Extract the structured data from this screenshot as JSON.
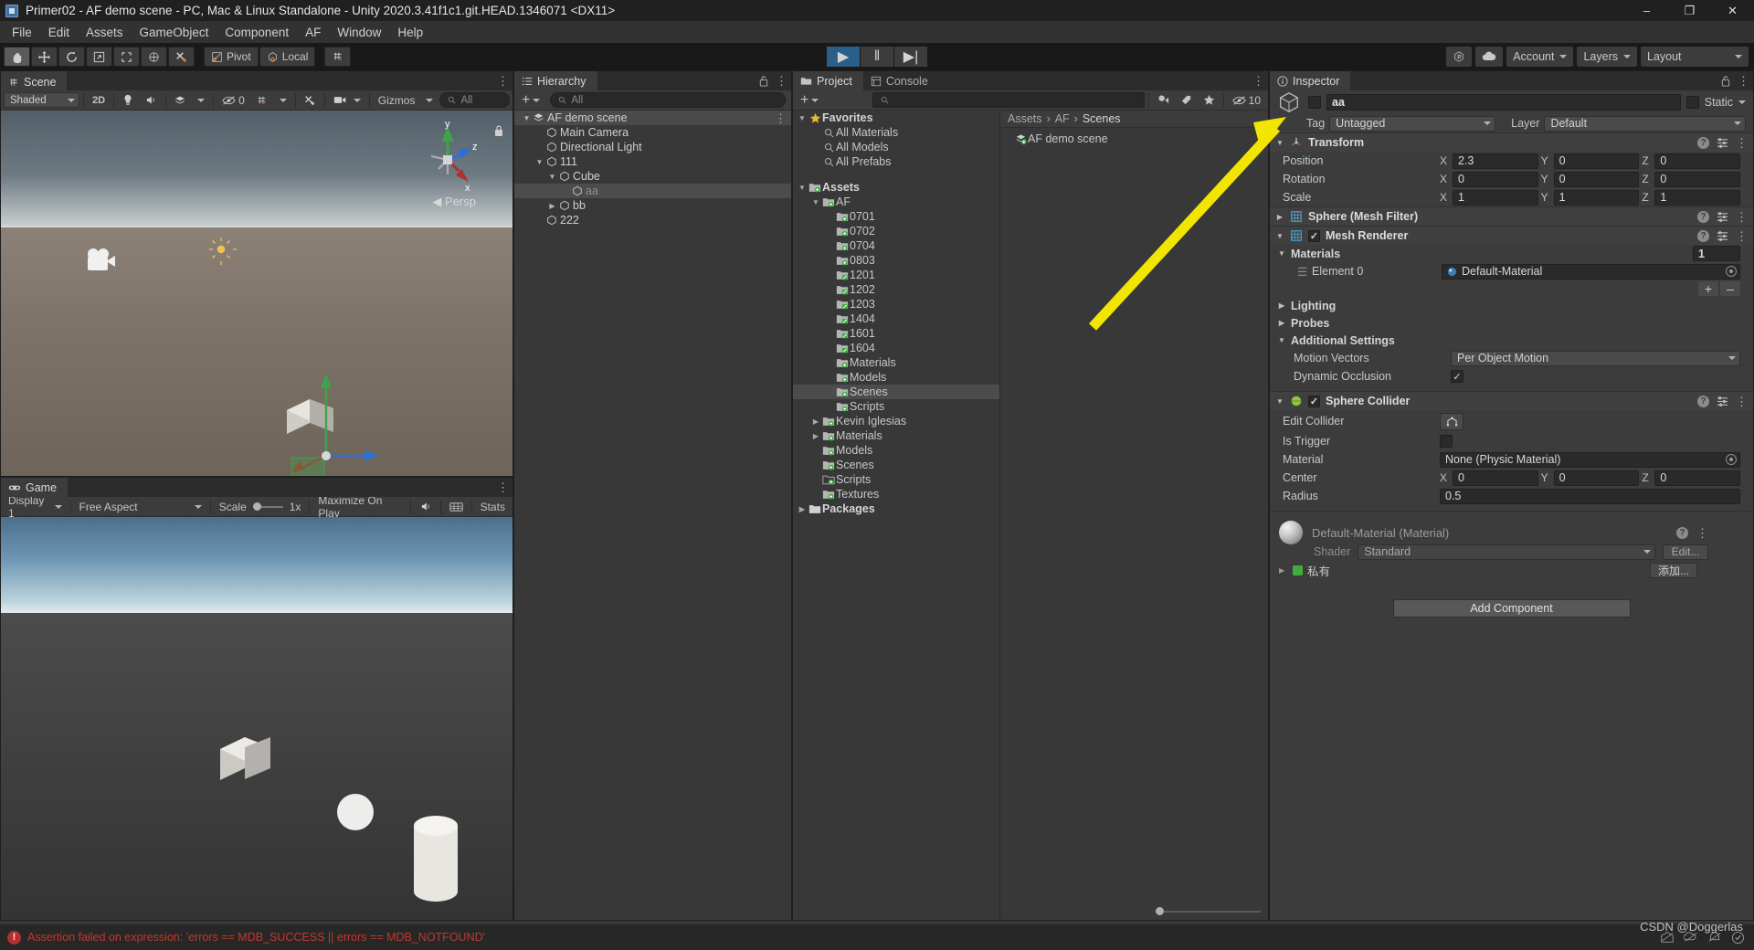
{
  "window": {
    "title": "Primer02 - AF demo scene - PC, Mac & Linux Standalone - Unity 2020.3.41f1c1.git.HEAD.1346071 <DX11>",
    "minimize": "–",
    "maximize": "❐",
    "close": "✕"
  },
  "menubar": {
    "items": [
      "File",
      "Edit",
      "Assets",
      "GameObject",
      "Component",
      "AF",
      "Window",
      "Help"
    ]
  },
  "toolbar": {
    "tools": [
      {
        "name": "hand-tool",
        "glyph": "✋",
        "active": true
      },
      {
        "name": "move-tool",
        "glyph": "✥",
        "active": false
      },
      {
        "name": "rotate-tool",
        "glyph": "↻",
        "active": false
      },
      {
        "name": "scale-tool",
        "glyph": "↗",
        "active": false
      },
      {
        "name": "rect-tool",
        "glyph": "⬚",
        "active": false
      },
      {
        "name": "transform-tool",
        "glyph": "⊕",
        "active": false
      },
      {
        "name": "custom-tool",
        "glyph": "⚒",
        "active": false
      }
    ],
    "pivot_label": "Pivot",
    "local_label": "Local",
    "snap_label": "",
    "play": "▶",
    "pause": "‖",
    "step": "▶|",
    "collab_label": "",
    "cloud_label": "",
    "account_label": "Account",
    "layers_label": "Layers",
    "layout_label": "Layout"
  },
  "scene": {
    "tab_label": "Scene",
    "shading_mode": "Shaded",
    "mode_2d": "2D",
    "audio_label": "",
    "fx_label": "",
    "hidden_count": "0",
    "gizmos_label": "Gizmos",
    "search_placeholder": "All",
    "persp_label": "◀ Persp",
    "axis_x": "x",
    "axis_y": "y",
    "axis_z": "z"
  },
  "game": {
    "tab_label": "Game",
    "display": "Display 1",
    "aspect": "Free Aspect",
    "scale_label": "Scale",
    "scale_value": "1x",
    "maximize_label": "Maximize On Play",
    "stats_label": "Stats"
  },
  "hierarchy": {
    "tab_label": "Hierarchy",
    "search_placeholder": "All",
    "add_label": "+",
    "rows": [
      {
        "label": "AF demo scene",
        "depth": 0,
        "tri": "down",
        "icon": "scene-icon",
        "state": "scene"
      },
      {
        "label": "Main Camera",
        "depth": 1,
        "tri": "",
        "icon": "gameobject-icon",
        "state": ""
      },
      {
        "label": "Directional Light",
        "depth": 1,
        "tri": "",
        "icon": "gameobject-icon",
        "state": ""
      },
      {
        "label": "111",
        "depth": 1,
        "tri": "down",
        "icon": "gameobject-icon",
        "state": ""
      },
      {
        "label": "Cube",
        "depth": 2,
        "tri": "down",
        "icon": "gameobject-icon",
        "state": ""
      },
      {
        "label": "aa",
        "depth": 3,
        "tri": "",
        "icon": "gameobject-icon",
        "state": "selected"
      },
      {
        "label": "bb",
        "depth": 2,
        "tri": "right",
        "icon": "gameobject-icon",
        "state": ""
      },
      {
        "label": "222",
        "depth": 1,
        "tri": "",
        "icon": "gameobject-icon",
        "state": ""
      }
    ]
  },
  "project": {
    "tab_label": "Project",
    "console_tab_label": "Console",
    "add_label": "+",
    "search_placeholder": "",
    "hidden_count": "10",
    "breadcrumb": [
      "Assets",
      "AF",
      "Scenes"
    ],
    "tree": [
      {
        "label": "Favorites",
        "depth": 0,
        "tri": "down",
        "icon": "star-icon",
        "bold": true,
        "state": ""
      },
      {
        "label": "All Materials",
        "depth": 1,
        "tri": "",
        "icon": "search-icon",
        "bold": false,
        "state": ""
      },
      {
        "label": "All Models",
        "depth": 1,
        "tri": "",
        "icon": "search-icon",
        "bold": false,
        "state": ""
      },
      {
        "label": "All Prefabs",
        "depth": 1,
        "tri": "",
        "icon": "search-icon",
        "bold": false,
        "state": ""
      },
      {
        "label": "",
        "depth": 0,
        "tri": "",
        "icon": "",
        "bold": false,
        "state": "spacer"
      },
      {
        "label": "Assets",
        "depth": 0,
        "tri": "down",
        "icon": "folder-vcs-icon",
        "bold": true,
        "state": ""
      },
      {
        "label": "AF",
        "depth": 1,
        "tri": "down",
        "icon": "folder-vcs-icon",
        "bold": false,
        "state": ""
      },
      {
        "label": "0701",
        "depth": 2,
        "tri": "",
        "icon": "folder-vcs-icon",
        "bold": false,
        "state": ""
      },
      {
        "label": "0702",
        "depth": 2,
        "tri": "",
        "icon": "folder-vcs-icon",
        "bold": false,
        "state": ""
      },
      {
        "label": "0704",
        "depth": 2,
        "tri": "",
        "icon": "folder-vcs-icon",
        "bold": false,
        "state": ""
      },
      {
        "label": "0803",
        "depth": 2,
        "tri": "",
        "icon": "folder-vcs-icon",
        "bold": false,
        "state": ""
      },
      {
        "label": "1201",
        "depth": 2,
        "tri": "",
        "icon": "folder-edit-icon",
        "bold": false,
        "state": ""
      },
      {
        "label": "1202",
        "depth": 2,
        "tri": "",
        "icon": "folder-edit-icon",
        "bold": false,
        "state": ""
      },
      {
        "label": "1203",
        "depth": 2,
        "tri": "",
        "icon": "folder-edit-icon",
        "bold": false,
        "state": ""
      },
      {
        "label": "1404",
        "depth": 2,
        "tri": "",
        "icon": "folder-edit-icon",
        "bold": false,
        "state": ""
      },
      {
        "label": "1601",
        "depth": 2,
        "tri": "",
        "icon": "folder-edit-icon",
        "bold": false,
        "state": ""
      },
      {
        "label": "1604",
        "depth": 2,
        "tri": "",
        "icon": "folder-edit-icon",
        "bold": false,
        "state": ""
      },
      {
        "label": "Materials",
        "depth": 2,
        "tri": "",
        "icon": "folder-vcs-icon",
        "bold": false,
        "state": ""
      },
      {
        "label": "Models",
        "depth": 2,
        "tri": "",
        "icon": "folder-vcs-icon",
        "bold": false,
        "state": ""
      },
      {
        "label": "Scenes",
        "depth": 2,
        "tri": "",
        "icon": "folder-vcs-icon",
        "bold": false,
        "state": "selected"
      },
      {
        "label": "Scripts",
        "depth": 2,
        "tri": "",
        "icon": "folder-vcs-icon",
        "bold": false,
        "state": ""
      },
      {
        "label": "Kevin Iglesias",
        "depth": 1,
        "tri": "right",
        "icon": "folder-vcs-icon",
        "bold": false,
        "state": ""
      },
      {
        "label": "Materials",
        "depth": 1,
        "tri": "right",
        "icon": "folder-vcs-icon",
        "bold": false,
        "state": ""
      },
      {
        "label": "Models",
        "depth": 1,
        "tri": "",
        "icon": "folder-vcs-icon",
        "bold": false,
        "state": ""
      },
      {
        "label": "Scenes",
        "depth": 1,
        "tri": "",
        "icon": "folder-vcs-icon",
        "bold": false,
        "state": ""
      },
      {
        "label": "Scripts",
        "depth": 1,
        "tri": "",
        "icon": "folder-empty-icon",
        "bold": false,
        "state": ""
      },
      {
        "label": "Textures",
        "depth": 1,
        "tri": "",
        "icon": "folder-vcs-icon",
        "bold": false,
        "state": ""
      },
      {
        "label": "Packages",
        "depth": 0,
        "tri": "right",
        "icon": "folder-plain-icon",
        "bold": true,
        "state": ""
      }
    ],
    "assets": [
      {
        "label": "AF demo scene",
        "icon": "scene-asset-icon"
      }
    ]
  },
  "inspector": {
    "tab_label": "Inspector",
    "object_name": "aa",
    "static_label": "Static",
    "tag_label": "Tag",
    "tag_value": "Untagged",
    "layer_label": "Layer",
    "layer_value": "Default",
    "transform": {
      "title": "Transform",
      "rows": [
        {
          "label": "Position",
          "x": "2.3",
          "y": "0",
          "z": "0"
        },
        {
          "label": "Rotation",
          "x": "0",
          "y": "0",
          "z": "0"
        },
        {
          "label": "Scale",
          "x": "1",
          "y": "1",
          "z": "1"
        }
      ]
    },
    "mesh_filter": {
      "title": "Sphere (Mesh Filter)"
    },
    "mesh_renderer": {
      "title": "Mesh Renderer",
      "materials_label": "Materials",
      "materials_count": "1",
      "element_label": "Element 0",
      "element_value": "Default-Material",
      "add_btn": "+",
      "remove_btn": "–",
      "lighting_label": "Lighting",
      "probes_label": "Probes",
      "additional_label": "Additional Settings",
      "motion_vectors_label": "Motion Vectors",
      "motion_vectors_value": "Per Object Motion",
      "dynamic_occlusion_label": "Dynamic Occlusion"
    },
    "sphere_collider": {
      "title": "Sphere Collider",
      "edit_collider_label": "Edit Collider",
      "is_trigger_label": "Is Trigger",
      "material_label": "Material",
      "material_value": "None (Physic Material)",
      "center_label": "Center",
      "center": {
        "x": "0",
        "y": "0",
        "z": "0"
      },
      "radius_label": "Radius",
      "radius_value": "0.5"
    },
    "material_preview": {
      "title": "Default-Material (Material)",
      "shader_label": "Shader",
      "shader_value": "Standard",
      "edit_label": "Edit...",
      "private_label": "私有",
      "add_label": "添加..."
    },
    "add_component_label": "Add Component"
  },
  "status": {
    "error_text": "Assertion failed on expression: 'errors == MDB_SUCCESS || errors == MDB_NOTFOUND'",
    "watermark": "CSDN @Doggerlas"
  },
  "colors": {
    "accent_blue": "#2b5f87",
    "error_red": "#c0392b",
    "arrow_yellow": "#f2e600",
    "selection": "#4c4c4c",
    "axis_x": "#c0392b",
    "axis_y": "#4caf50",
    "axis_z": "#2f6fd0"
  }
}
